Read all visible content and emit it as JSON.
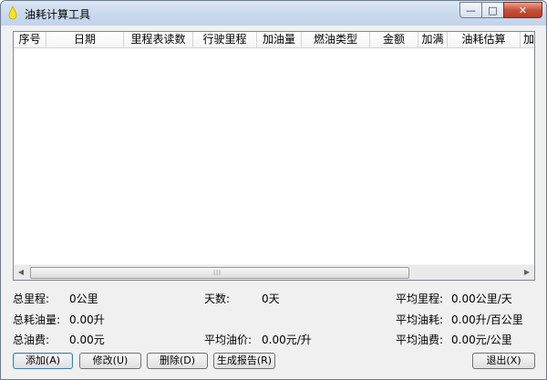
{
  "window": {
    "title": "油耗计算工具",
    "minimize": "—",
    "maximize": "□",
    "close": "✕"
  },
  "table": {
    "columns": [
      "序号",
      "日期",
      "里程表读数",
      "行驶里程",
      "加油量",
      "燃油类型",
      "金额",
      "加满",
      "油耗估算",
      "加"
    ],
    "rows": []
  },
  "scrollbar": {
    "left": "◀",
    "right": "▶",
    "grip": "|||"
  },
  "stats": {
    "total_mileage": {
      "label": "总里程:",
      "value": "0公里"
    },
    "days": {
      "label": "天数:",
      "value": "0天"
    },
    "avg_mileage": {
      "label": "平均里程:",
      "value": "0.00公里/天"
    },
    "total_fuel": {
      "label": "总耗油量:",
      "value": "0.00升"
    },
    "avg_consumption": {
      "label": "平均油耗:",
      "value": "0.00升/百公里"
    },
    "total_cost": {
      "label": "总油费:",
      "value": "0.00元"
    },
    "avg_price": {
      "label": "平均油价:",
      "value": "0.00元/升"
    },
    "avg_cost": {
      "label": "平均油费:",
      "value": "0.00元/公里"
    }
  },
  "buttons": {
    "add": "添加(A)",
    "edit": "修改(U)",
    "delete": "删除(D)",
    "report": "生成报告(R)",
    "exit": "退出(X)"
  }
}
